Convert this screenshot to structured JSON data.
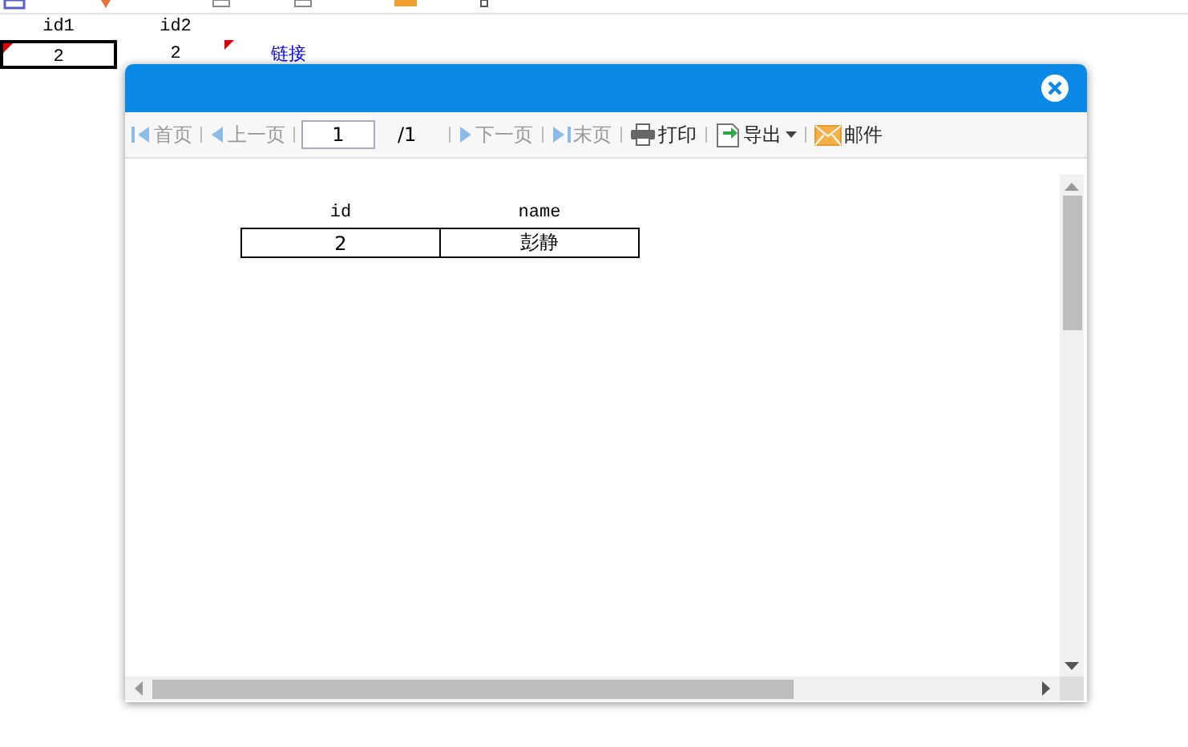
{
  "sheet": {
    "headers": [
      "id1",
      "id2"
    ],
    "row": {
      "cell_1": "2",
      "cell_1_selected": true,
      "cell_2": "2",
      "link": "链接"
    }
  },
  "dialog": {
    "toolbar": [
      {
        "kind": "first",
        "label": "首页",
        "disabled": true
      },
      {
        "kind": "prev",
        "label": "上一页",
        "disabled": true
      },
      {
        "kind": "page",
        "value": "1",
        "total": "/1"
      },
      {
        "kind": "next",
        "label": "下一页",
        "disabled": true
      },
      {
        "kind": "last",
        "label": "末页",
        "disabled": true
      },
      {
        "kind": "print",
        "label": "打印",
        "disabled": false
      },
      {
        "kind": "export",
        "label": "导出",
        "disabled": false
      },
      {
        "kind": "mail",
        "label": "邮件",
        "disabled": false
      }
    ],
    "report": {
      "columns": [
        "id",
        "name"
      ],
      "rows": [
        [
          "2",
          "彭静"
        ]
      ]
    }
  }
}
